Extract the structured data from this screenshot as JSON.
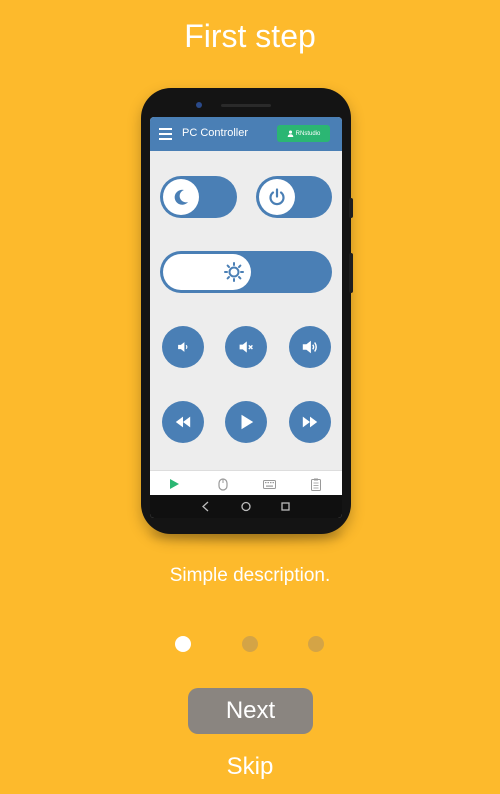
{
  "onboarding": {
    "title": "First step",
    "description": "Simple description.",
    "next_label": "Next",
    "skip_label": "Skip",
    "pagination": {
      "total": 3,
      "active": 1
    },
    "colors": {
      "background": "#FDBA2C",
      "dot_active": "#FFFFFF",
      "dot_inactive": "#D4A446",
      "next_button": "#8A8580"
    }
  },
  "phone_app": {
    "title": "PC Controller",
    "user_badge": "RNstudio",
    "accent": "#4A7FB5",
    "badge_color": "#2BB673",
    "controls": {
      "toggles": [
        "moon-icon",
        "power-icon"
      ],
      "slider": "brightness-icon",
      "volume": [
        "volume-down-icon",
        "mute-icon",
        "volume-up-icon"
      ],
      "media": [
        "rewind-icon",
        "play-icon",
        "fast-forward-icon"
      ]
    },
    "bottom_nav": [
      "play-tab-icon",
      "mouse-tab-icon",
      "keyboard-tab-icon",
      "clipboard-tab-icon"
    ],
    "active_tab_color": "#2BB673"
  }
}
